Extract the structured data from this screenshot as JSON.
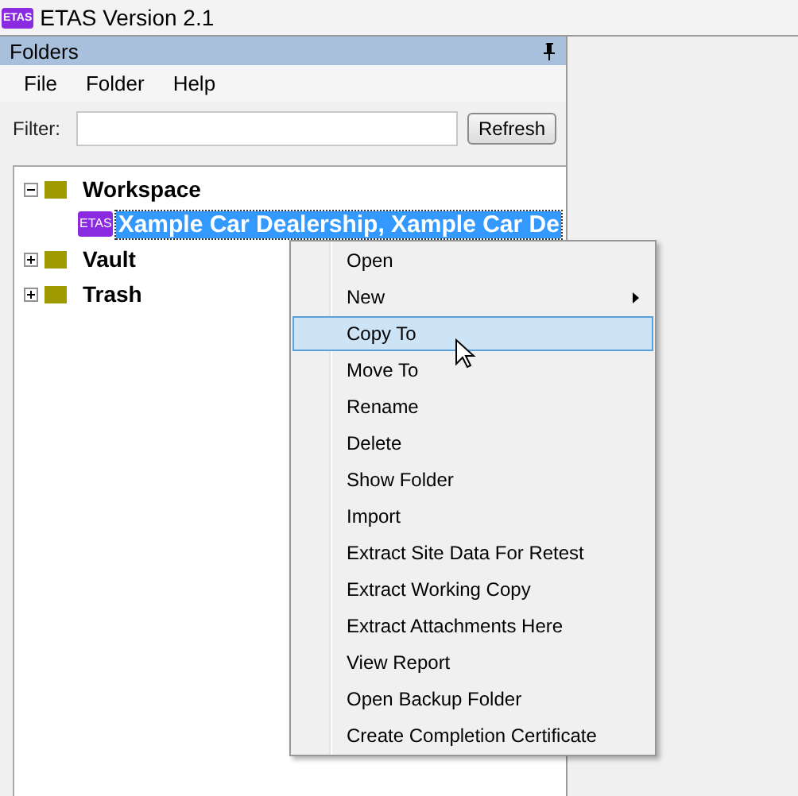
{
  "window": {
    "title": "ETAS Version 2.1",
    "app_icon": "ETAS"
  },
  "panel": {
    "title": "Folders"
  },
  "menu_bar": [
    "File",
    "Folder",
    "Help"
  ],
  "filter": {
    "label": "Filter:",
    "button": "Refresh"
  },
  "tree": [
    {
      "label": "Workspace",
      "kind": "folder",
      "expanded": true,
      "selected": false,
      "children": [
        {
          "label": "Xample Car Dealership, Xample Car De",
          "kind": "report",
          "badge": "ETAS",
          "selected": true
        }
      ]
    },
    {
      "label": "Vault",
      "kind": "folder",
      "expanded": false,
      "selected": false
    },
    {
      "label": "Trash",
      "kind": "folder",
      "expanded": false,
      "selected": false
    }
  ],
  "context_menu": [
    {
      "label": "Open",
      "selected": false,
      "submenu": false
    },
    {
      "label": "New",
      "selected": false,
      "submenu": true
    },
    {
      "label": "Copy To",
      "selected": true,
      "submenu": false
    },
    {
      "label": "Move To",
      "selected": false,
      "submenu": false
    },
    {
      "label": "Rename",
      "selected": false,
      "submenu": false
    },
    {
      "label": "Delete",
      "selected": false,
      "submenu": false
    },
    {
      "label": "Show Folder",
      "selected": false,
      "submenu": false
    },
    {
      "label": "Import",
      "selected": false,
      "submenu": false
    },
    {
      "label": "Extract Site Data For Retest",
      "selected": false,
      "submenu": false
    },
    {
      "label": "Extract Working Copy",
      "selected": false,
      "submenu": false
    },
    {
      "label": "Extract Attachments Here",
      "selected": false,
      "submenu": false
    },
    {
      "label": "View Report",
      "selected": false,
      "submenu": false
    },
    {
      "label": "Open Backup Folder",
      "selected": false,
      "submenu": false
    },
    {
      "label": "Create Completion Certificate",
      "selected": false,
      "submenu": false
    }
  ]
}
